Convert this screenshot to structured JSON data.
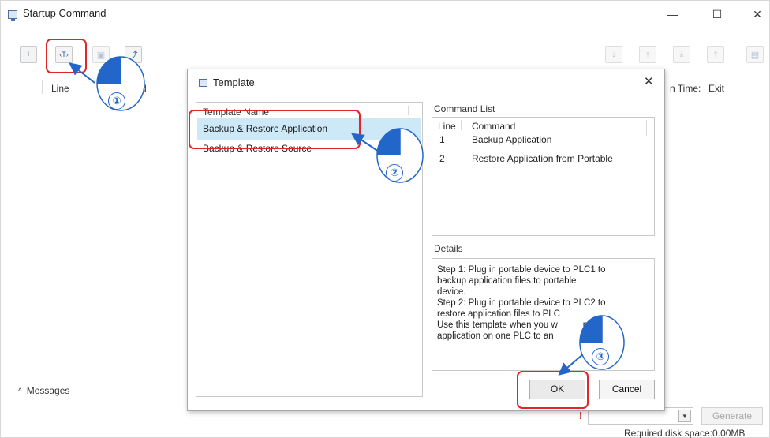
{
  "window": {
    "title": "Startup Command",
    "controls": {
      "minimize": "—",
      "maximize": "☐",
      "close": "✕"
    }
  },
  "toolbar": {
    "left_buttons": [
      {
        "name": "add-command-button",
        "glyph": "+"
      },
      {
        "name": "template-button",
        "glyph": "‹T›"
      },
      {
        "name": "save-button",
        "glyph": "▣"
      },
      {
        "name": "export-button",
        "glyph": "⤴"
      }
    ],
    "right_buttons": [
      {
        "name": "move-down-button",
        "glyph": "↓"
      },
      {
        "name": "move-up-button",
        "glyph": "↑"
      },
      {
        "name": "move-bottom-button",
        "glyph": "⤓"
      },
      {
        "name": "move-top-button",
        "glyph": "⤒"
      },
      {
        "name": "delete-button",
        "glyph": "▤"
      }
    ]
  },
  "grid": {
    "columns": {
      "line": "Line",
      "command_partial": "d",
      "times_partial": "n Time:",
      "exit": "Exit"
    }
  },
  "messages": {
    "label": "Messages",
    "chevron": "^"
  },
  "footer": {
    "warning": "!",
    "generate_label": "Generate",
    "disk_space": "Required disk space:0.00MB"
  },
  "dialog": {
    "title": "Template",
    "close": "✕",
    "template_list": {
      "header": "Template Name",
      "items": [
        {
          "label": "Backup & Restore Application",
          "selected": true
        },
        {
          "label": "Backup & Restore Source",
          "selected": false
        }
      ]
    },
    "command_list": {
      "label": "Command List",
      "headers": {
        "line": "Line",
        "command": "Command"
      },
      "rows": [
        {
          "line": "1",
          "command": "Backup Application"
        },
        {
          "line": "2",
          "command": "Restore Application from Portable"
        }
      ]
    },
    "details": {
      "label": "Details",
      "lines": [
        "Step 1: Plug in portable device to PLC1 to",
        "backup application files to portable",
        "device.",
        "Step 2: Plug in portable device to PLC2 to",
        "restore application files to PLC",
        "Use this template when you w          pply",
        "application on one PLC to an"
      ]
    },
    "ok_label": "OK",
    "cancel_label": "Cancel"
  },
  "annotations": {
    "steps": [
      "①",
      "②",
      "③"
    ],
    "highlight_color": "#e0252b",
    "pointer_color": "#2266c9"
  }
}
